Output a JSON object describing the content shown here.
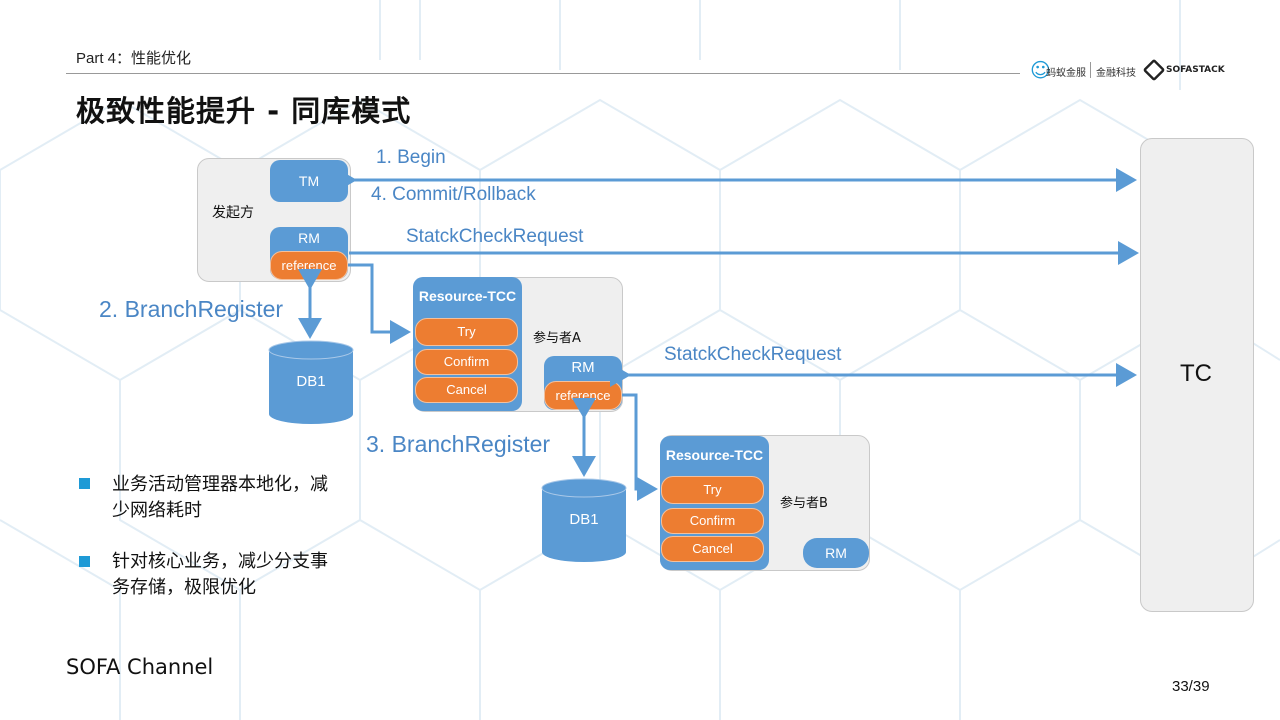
{
  "header": {
    "section": "Part 4：性能优化",
    "title": "极致性能提升 - 同库模式",
    "logos": {
      "ant_financial": "蚂蚁金服",
      "fintech": "金融科技",
      "sofastack": "SOFASTACK"
    }
  },
  "diagram": {
    "initiator": {
      "label": "发起方",
      "tm": "TM",
      "rm": "RM",
      "reference": "reference"
    },
    "db_initiator": "DB1",
    "participant_a": {
      "label": "参与者A",
      "resource": "Resource-TCC",
      "try": "Try",
      "confirm": "Confirm",
      "cancel": "Cancel",
      "rm": "RM",
      "reference": "reference"
    },
    "db_participant_a": "DB1",
    "participant_b": {
      "label": "参与者B",
      "resource": "Resource-TCC",
      "try": "Try",
      "confirm": "Confirm",
      "cancel": "Cancel",
      "rm": "RM"
    },
    "tc": "TC",
    "edges": {
      "begin": "1. Begin",
      "commit": "4. Commit/Rollback",
      "check1": "StatckCheckRequest",
      "check2": "StatckCheckRequest",
      "branch2": "2. BranchRegister",
      "branch3": "3. BranchRegister"
    }
  },
  "bullets": [
    {
      "line1": "业务活动管理器本地化，减",
      "line2": "少网络耗时"
    },
    {
      "line1": "针对核心业务，减少分支事",
      "line2": "务存储，极限优化"
    }
  ],
  "footer": {
    "brand": "SOFA Channel",
    "page": "33/39"
  },
  "colors": {
    "blue": "#5b9bd5",
    "orange": "#ed7d31",
    "grey_box": "#efefef",
    "bullet": "#1e9ad6"
  }
}
